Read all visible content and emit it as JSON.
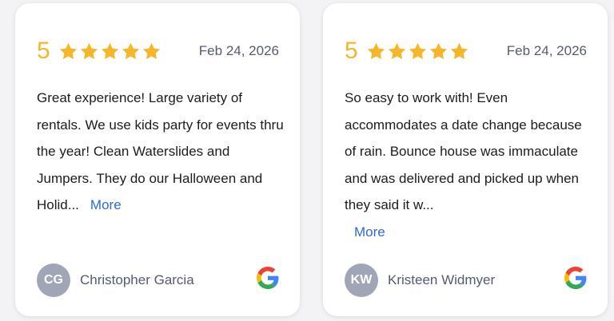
{
  "reviews": [
    {
      "rating": "5",
      "stars": 5,
      "date": "Feb 24, 2026",
      "text": "Great experience! Large variety of rentals. We use kids party for events thru the year! Clean Waterslides and Jumpers. They do our Halloween and Holid...",
      "more_label": "More",
      "author_initials": "CG",
      "author_name": "Christopher Garcia",
      "source_icon": "google-icon"
    },
    {
      "rating": "5",
      "stars": 5,
      "date": "Feb 24, 2026",
      "text": "So easy to work with! Even accommodates a date change because of rain. Bounce house was immaculate and was delivered and picked up when they said it w...",
      "more_label": "More",
      "author_initials": "KW",
      "author_name": "Kristeen Widmyer",
      "source_icon": "google-icon"
    }
  ],
  "colors": {
    "star": "#f5b62a",
    "link": "#2f68d6",
    "avatar_bg": "#a0a6b5",
    "muted_text": "#555b6e"
  }
}
